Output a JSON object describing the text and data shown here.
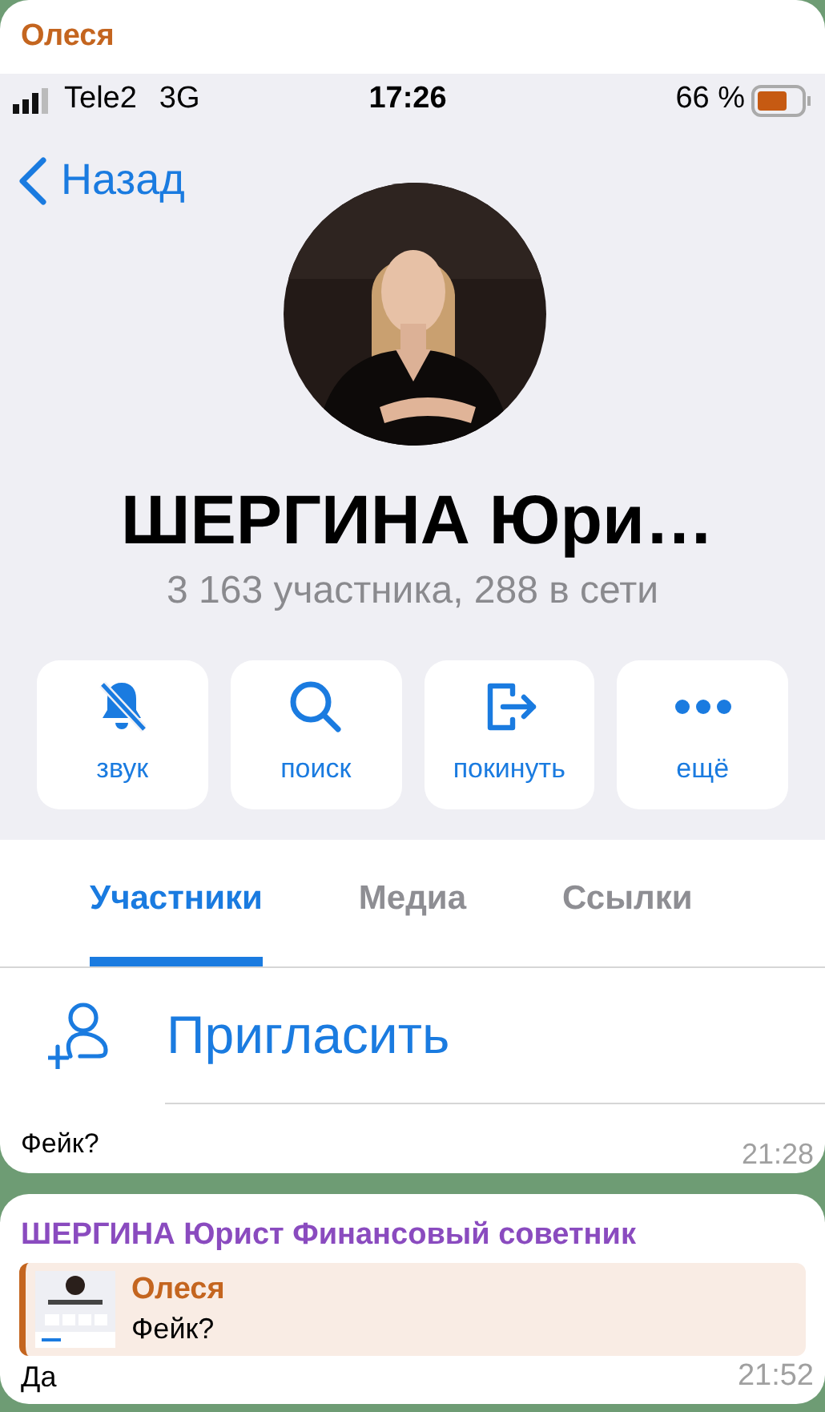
{
  "messages": [
    {
      "sender": "Олеся",
      "color": "#c4651f",
      "screenshot": {
        "status_bar": {
          "carrier": "Tele2",
          "network": "3G",
          "time": "17:26",
          "battery_text": "66 %"
        },
        "back": "Назад",
        "title": "ШЕРГИНА Юри…",
        "subtitle": "3 163 участника, 288 в сети",
        "actions": [
          {
            "kind": "mute",
            "label": "звук"
          },
          {
            "kind": "search",
            "label": "поиск"
          },
          {
            "kind": "leave",
            "label": "покинуть"
          },
          {
            "kind": "more",
            "label": "ещё"
          }
        ],
        "tabs": [
          {
            "label": "Участники",
            "selected": true
          },
          {
            "label": "Медиа",
            "selected": false
          },
          {
            "label": "Ссылки",
            "selected": false
          }
        ],
        "invite": "Пригласить"
      },
      "text": "Фейк?",
      "time": "21:28"
    },
    {
      "kind": "reply",
      "sender": "ШЕРГИНА Юрист Финансовый советник",
      "color": "#8a4bbf",
      "reply_to": {
        "sender": "Олеся",
        "text": "Фейк?"
      },
      "text": "Да",
      "time": "21:52"
    }
  ]
}
